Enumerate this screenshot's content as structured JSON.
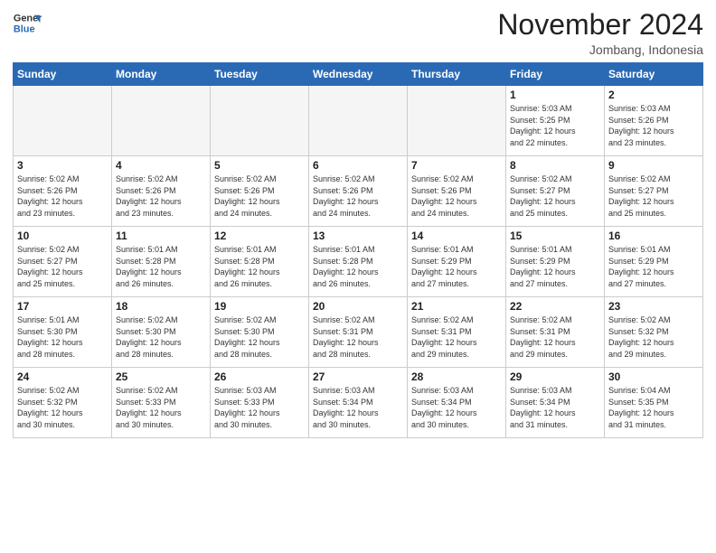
{
  "logo": {
    "general": "General",
    "blue": "Blue"
  },
  "header": {
    "month": "November 2024",
    "location": "Jombang, Indonesia"
  },
  "weekdays": [
    "Sunday",
    "Monday",
    "Tuesday",
    "Wednesday",
    "Thursday",
    "Friday",
    "Saturday"
  ],
  "weeks": [
    [
      {
        "day": "",
        "sunrise": "",
        "sunset": "",
        "daylight": "",
        "empty": true
      },
      {
        "day": "",
        "sunrise": "",
        "sunset": "",
        "daylight": "",
        "empty": true
      },
      {
        "day": "",
        "sunrise": "",
        "sunset": "",
        "daylight": "",
        "empty": true
      },
      {
        "day": "",
        "sunrise": "",
        "sunset": "",
        "daylight": "",
        "empty": true
      },
      {
        "day": "",
        "sunrise": "",
        "sunset": "",
        "daylight": "",
        "empty": true
      },
      {
        "day": "1",
        "sunrise": "5:03 AM",
        "sunset": "5:25 PM",
        "daylight": "12 hours and 22 minutes.",
        "empty": false
      },
      {
        "day": "2",
        "sunrise": "5:03 AM",
        "sunset": "5:26 PM",
        "daylight": "12 hours and 23 minutes.",
        "empty": false
      }
    ],
    [
      {
        "day": "3",
        "sunrise": "5:02 AM",
        "sunset": "5:26 PM",
        "daylight": "12 hours and 23 minutes.",
        "empty": false
      },
      {
        "day": "4",
        "sunrise": "5:02 AM",
        "sunset": "5:26 PM",
        "daylight": "12 hours and 23 minutes.",
        "empty": false
      },
      {
        "day": "5",
        "sunrise": "5:02 AM",
        "sunset": "5:26 PM",
        "daylight": "12 hours and 24 minutes.",
        "empty": false
      },
      {
        "day": "6",
        "sunrise": "5:02 AM",
        "sunset": "5:26 PM",
        "daylight": "12 hours and 24 minutes.",
        "empty": false
      },
      {
        "day": "7",
        "sunrise": "5:02 AM",
        "sunset": "5:26 PM",
        "daylight": "12 hours and 24 minutes.",
        "empty": false
      },
      {
        "day": "8",
        "sunrise": "5:02 AM",
        "sunset": "5:27 PM",
        "daylight": "12 hours and 25 minutes.",
        "empty": false
      },
      {
        "day": "9",
        "sunrise": "5:02 AM",
        "sunset": "5:27 PM",
        "daylight": "12 hours and 25 minutes.",
        "empty": false
      }
    ],
    [
      {
        "day": "10",
        "sunrise": "5:02 AM",
        "sunset": "5:27 PM",
        "daylight": "12 hours and 25 minutes.",
        "empty": false
      },
      {
        "day": "11",
        "sunrise": "5:01 AM",
        "sunset": "5:28 PM",
        "daylight": "12 hours and 26 minutes.",
        "empty": false
      },
      {
        "day": "12",
        "sunrise": "5:01 AM",
        "sunset": "5:28 PM",
        "daylight": "12 hours and 26 minutes.",
        "empty": false
      },
      {
        "day": "13",
        "sunrise": "5:01 AM",
        "sunset": "5:28 PM",
        "daylight": "12 hours and 26 minutes.",
        "empty": false
      },
      {
        "day": "14",
        "sunrise": "5:01 AM",
        "sunset": "5:29 PM",
        "daylight": "12 hours and 27 minutes.",
        "empty": false
      },
      {
        "day": "15",
        "sunrise": "5:01 AM",
        "sunset": "5:29 PM",
        "daylight": "12 hours and 27 minutes.",
        "empty": false
      },
      {
        "day": "16",
        "sunrise": "5:01 AM",
        "sunset": "5:29 PM",
        "daylight": "12 hours and 27 minutes.",
        "empty": false
      }
    ],
    [
      {
        "day": "17",
        "sunrise": "5:01 AM",
        "sunset": "5:30 PM",
        "daylight": "12 hours and 28 minutes.",
        "empty": false
      },
      {
        "day": "18",
        "sunrise": "5:02 AM",
        "sunset": "5:30 PM",
        "daylight": "12 hours and 28 minutes.",
        "empty": false
      },
      {
        "day": "19",
        "sunrise": "5:02 AM",
        "sunset": "5:30 PM",
        "daylight": "12 hours and 28 minutes.",
        "empty": false
      },
      {
        "day": "20",
        "sunrise": "5:02 AM",
        "sunset": "5:31 PM",
        "daylight": "12 hours and 28 minutes.",
        "empty": false
      },
      {
        "day": "21",
        "sunrise": "5:02 AM",
        "sunset": "5:31 PM",
        "daylight": "12 hours and 29 minutes.",
        "empty": false
      },
      {
        "day": "22",
        "sunrise": "5:02 AM",
        "sunset": "5:31 PM",
        "daylight": "12 hours and 29 minutes.",
        "empty": false
      },
      {
        "day": "23",
        "sunrise": "5:02 AM",
        "sunset": "5:32 PM",
        "daylight": "12 hours and 29 minutes.",
        "empty": false
      }
    ],
    [
      {
        "day": "24",
        "sunrise": "5:02 AM",
        "sunset": "5:32 PM",
        "daylight": "12 hours and 30 minutes.",
        "empty": false
      },
      {
        "day": "25",
        "sunrise": "5:02 AM",
        "sunset": "5:33 PM",
        "daylight": "12 hours and 30 minutes.",
        "empty": false
      },
      {
        "day": "26",
        "sunrise": "5:03 AM",
        "sunset": "5:33 PM",
        "daylight": "12 hours and 30 minutes.",
        "empty": false
      },
      {
        "day": "27",
        "sunrise": "5:03 AM",
        "sunset": "5:34 PM",
        "daylight": "12 hours and 30 minutes.",
        "empty": false
      },
      {
        "day": "28",
        "sunrise": "5:03 AM",
        "sunset": "5:34 PM",
        "daylight": "12 hours and 30 minutes.",
        "empty": false
      },
      {
        "day": "29",
        "sunrise": "5:03 AM",
        "sunset": "5:34 PM",
        "daylight": "12 hours and 31 minutes.",
        "empty": false
      },
      {
        "day": "30",
        "sunrise": "5:04 AM",
        "sunset": "5:35 PM",
        "daylight": "12 hours and 31 minutes.",
        "empty": false
      }
    ]
  ]
}
